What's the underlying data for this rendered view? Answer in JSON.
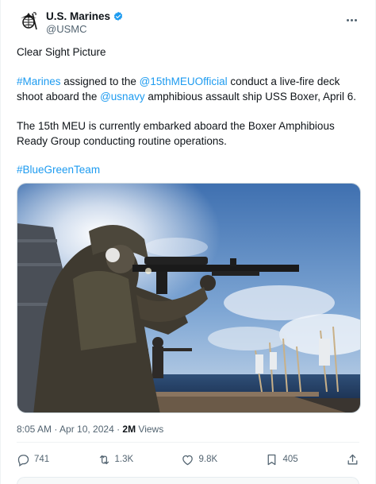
{
  "author": {
    "display_name": "U.S. Marines",
    "handle": "@USMC",
    "verified": true
  },
  "icons": {
    "more": "more-icon",
    "verified": "verified-badge-icon",
    "reply": "reply-icon",
    "repost": "repost-icon",
    "like": "like-icon",
    "bookmark": "bookmark-icon",
    "share": "share-icon"
  },
  "post": {
    "title_line": "Clear Sight Picture",
    "para1": {
      "tag1": "#Marines",
      "t1": " assigned to the ",
      "mention1": "@15thMEUOfficial",
      "t2": " conduct a live-fire deck shoot aboard the ",
      "mention2": "@usnavy",
      "t3": " amphibious assault ship USS Boxer, April 6."
    },
    "para2": "The 15th MEU is currently embarked aboard the Boxer Amphibious Ready Group conducting routine operations.",
    "hashtag": "#BlueGreenTeam"
  },
  "meta": {
    "timestamp": "8:05 AM · Apr 10, 2024 · ",
    "views_count": "2M",
    "views_label": " Views"
  },
  "actions": {
    "replies": "741",
    "reposts": "1.3K",
    "likes": "9.8K",
    "bookmarks": "405"
  },
  "colors": {
    "link": "#1d9bf0",
    "verified": "#1d9bf0",
    "secondary_text": "#536471",
    "primary_text": "#0f1419"
  }
}
